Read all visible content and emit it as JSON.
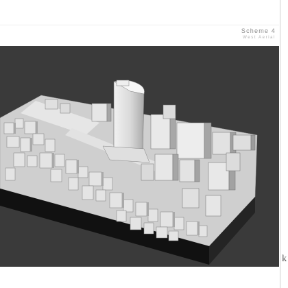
{
  "header": {
    "title": "Scheme 4",
    "subtitle": "West Aerial"
  },
  "image": {
    "subject": "aerial-3d-massing-model",
    "background_color": "#3a3a3a",
    "model_color": "#d8d8d8"
  },
  "logo": {
    "text": "k"
  }
}
